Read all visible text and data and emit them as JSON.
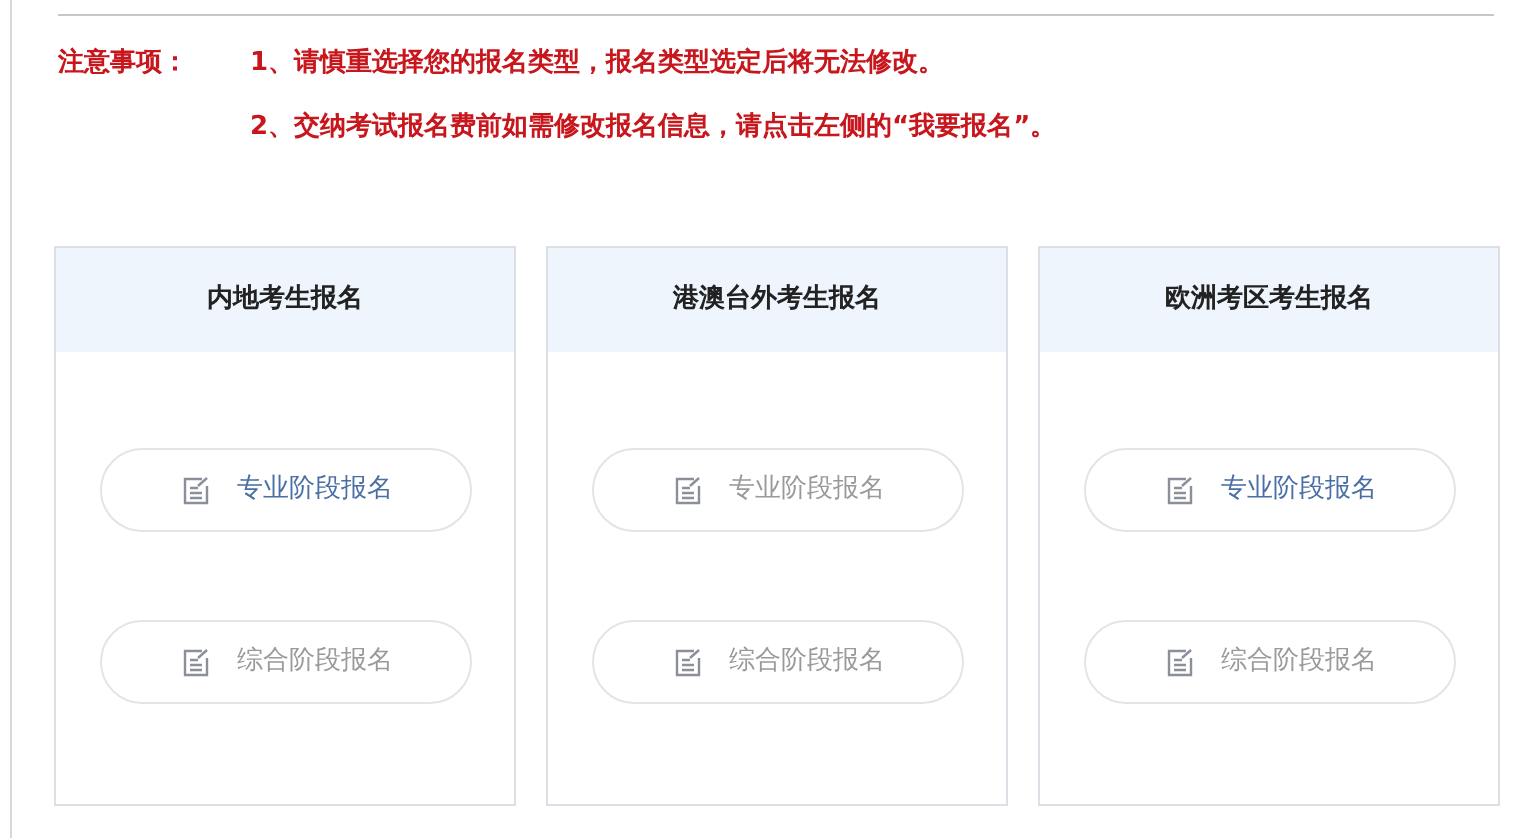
{
  "notice": {
    "label": "注意事项：",
    "items": [
      "1、请慎重选择您的报名类型，报名类型选定后将无法修改。",
      "2、交纳考试报名费前如需修改报名信息，请点击左侧的“我要报名”。"
    ]
  },
  "cards": [
    {
      "title": "内地考生报名",
      "buttons": [
        {
          "label": "专业阶段报名",
          "disabled": false
        },
        {
          "label": "综合阶段报名",
          "disabled": true
        }
      ]
    },
    {
      "title": "港澳台外考生报名",
      "buttons": [
        {
          "label": "专业阶段报名",
          "disabled": true
        },
        {
          "label": "综合阶段报名",
          "disabled": true
        }
      ]
    },
    {
      "title": "欧洲考区考生报名",
      "buttons": [
        {
          "label": "专业阶段报名",
          "disabled": false
        },
        {
          "label": "综合阶段报名",
          "disabled": true
        }
      ]
    }
  ]
}
